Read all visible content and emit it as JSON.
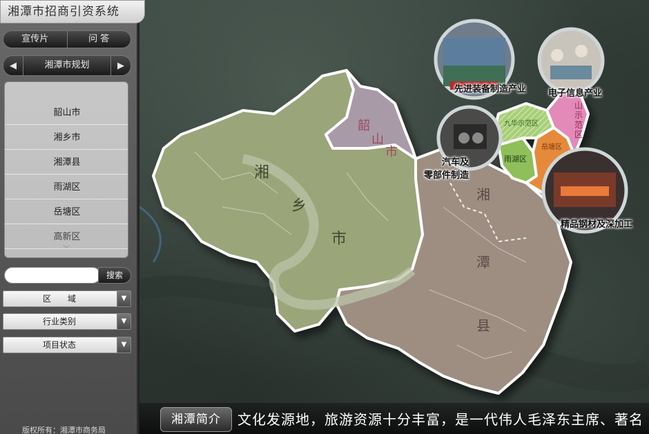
{
  "app": {
    "title": "湘潭市招商引资系统"
  },
  "sidebar": {
    "top_buttons": [
      "宣传片",
      "问 答"
    ],
    "nav": {
      "prev_icon": "◀",
      "label": "湘潭市规划",
      "next_icon": "▶"
    },
    "districts": [
      "韶山市",
      "湘乡市",
      "湘潭县",
      "雨湖区",
      "岳塘区",
      "高新区"
    ],
    "search": {
      "placeholder": "",
      "button_label": "搜索"
    },
    "filters": [
      {
        "label": "区　　域"
      },
      {
        "label": "行业类别"
      },
      {
        "label": "项目状态"
      }
    ],
    "dropdown_icon": "▼",
    "copyright": "版权所有：湘潭市商务局"
  },
  "map": {
    "regions": {
      "xiangxiang": [
        "湘",
        "乡",
        "市"
      ],
      "shaoshan": [
        "韶",
        "山",
        "市"
      ],
      "xiangtan_county": [
        "湘",
        "潭",
        "县"
      ],
      "jiuhua": "九华示范区",
      "yuhu": "雨湖区",
      "shanshi": [
        "山",
        "示",
        "范",
        "区"
      ],
      "yuetang": "岳塘区"
    },
    "industries": [
      {
        "name": "先进装备制造产业",
        "icon": "factory-photo-icon"
      },
      {
        "name": "电子信息产业",
        "icon": "electronics-photo-icon"
      },
      {
        "name_line1": "汽车及",
        "name_line2": "零部件制造",
        "icon": "car-engine-photo-icon"
      },
      {
        "name": "精品钢材及深加工",
        "icon": "steel-photo-icon"
      }
    ],
    "colors": {
      "xiangxiang": "#9aa57a",
      "shaoshan": "#a99aa8",
      "xiangtan_county": "#9e8e82",
      "yuhu": "#8fbf5a",
      "yuetang": "#e58a3a",
      "shanshi": "#e48ab8",
      "river": "#b9c4a8"
    }
  },
  "footer": {
    "intro_button": "湘潭简介",
    "ticker_text": "文化发源地，旅游资源十分丰富，是一代伟人毛泽东主席、著名"
  }
}
